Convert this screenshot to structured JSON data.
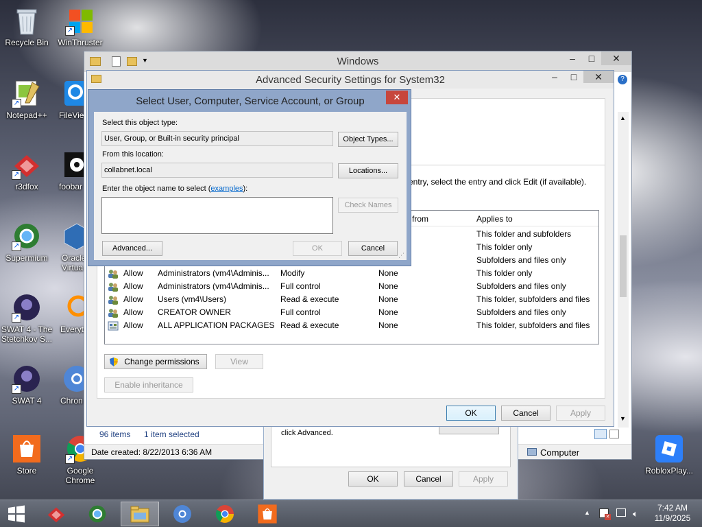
{
  "desktop": {
    "icons": [
      {
        "label": "Recycle Bin"
      },
      {
        "label": "WinThruster"
      },
      {
        "label": "Notepad++"
      },
      {
        "label": "FileVie"
      },
      {
        "label": "r3dfox"
      },
      {
        "label": "foobar"
      },
      {
        "label": "Supermium"
      },
      {
        "label": "Oracle"
      },
      {
        "label": "Virtua"
      },
      {
        "label": "SWAT 4 - The"
      },
      {
        "label": "Stetchkov S..."
      },
      {
        "label": "Everyt"
      },
      {
        "label": "SWAT 4"
      },
      {
        "label": "Chron"
      },
      {
        "label": "Store"
      },
      {
        "label": "Google"
      },
      {
        "label": "Chrome"
      },
      {
        "label": "RobloxPlay..."
      }
    ]
  },
  "explorer": {
    "title": "Windows",
    "status_items": "96 items",
    "status_selected": "1 item selected",
    "date_created": "Date created: 8/22/2013 6:36 AM",
    "computer_label": "Computer"
  },
  "properties_dialog": {
    "text": "click Advanced.",
    "ok": "OK",
    "cancel": "Cancel",
    "apply": "Apply"
  },
  "advanced_security": {
    "title": "Advanced Security Settings for System32",
    "info_text": "entry, select the entry and click Edit (if available).",
    "columns": {
      "inherited_from": "from",
      "applies_to": "Applies to"
    },
    "partial_rows": [
      {
        "applies": "This folder and subfolders"
      },
      {
        "applies": "This folder only"
      },
      {
        "applies": "Subfolders and files only"
      }
    ],
    "rows": [
      {
        "type": "Allow",
        "principal": "Administrators (vm4\\Adminis...",
        "access": "Modify",
        "inherited": "None",
        "applies": "This folder only"
      },
      {
        "type": "Allow",
        "principal": "Administrators (vm4\\Adminis...",
        "access": "Full control",
        "inherited": "None",
        "applies": "Subfolders and files only"
      },
      {
        "type": "Allow",
        "principal": "Users (vm4\\Users)",
        "access": "Read & execute",
        "inherited": "None",
        "applies": "This folder, subfolders and files"
      },
      {
        "type": "Allow",
        "principal": "CREATOR OWNER",
        "access": "Full control",
        "inherited": "None",
        "applies": "Subfolders and files only"
      },
      {
        "type": "Allow",
        "principal": "ALL APPLICATION PACKAGES",
        "access": "Read & execute",
        "inherited": "None",
        "applies": "This folder, subfolders and files"
      }
    ],
    "change_permissions": "Change permissions",
    "view": "View",
    "enable_inheritance": "Enable inheritance",
    "ok": "OK",
    "cancel": "Cancel",
    "apply": "Apply"
  },
  "select_user": {
    "title": "Select User, Computer, Service Account, or Group",
    "object_type_label": "Select this object type:",
    "object_type_value": "User, Group, or Built-in security principal",
    "object_types_button": "Object Types...",
    "location_label": "From this location:",
    "location_value": "collabnet.local",
    "locations_button": "Locations...",
    "enter_name_label": "Enter the object name to select (",
    "examples_link": "examples",
    "enter_name_suffix": "):",
    "object_name_value": "",
    "check_names": "Check Names",
    "advanced": "Advanced...",
    "ok": "OK",
    "cancel": "Cancel"
  },
  "taskbar": {
    "time": "7:42 AM",
    "date": "11/9/2025"
  },
  "colors": {
    "dialog_frame": "#8fa6c9",
    "close_red": "#c7463c",
    "link": "#0066cc",
    "taskbar": "#565b66"
  }
}
